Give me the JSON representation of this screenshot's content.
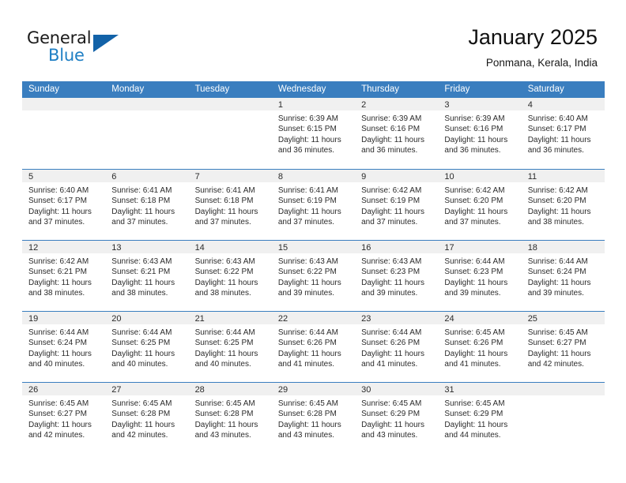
{
  "brand": {
    "word1": "General",
    "word2": "Blue",
    "triangle_color": "#1262a8",
    "blue_color": "#1f7fc4"
  },
  "header": {
    "title": "January 2025",
    "subtitle": "Ponmana, Kerala, India"
  },
  "theme": {
    "header_bar": "#3a7ebf",
    "daynum_bar": "#f0f0f0",
    "text": "#2b2b2b"
  },
  "weekdays": [
    "Sunday",
    "Monday",
    "Tuesday",
    "Wednesday",
    "Thursday",
    "Friday",
    "Saturday"
  ],
  "weeks": [
    [
      {
        "day": "",
        "empty": true
      },
      {
        "day": "",
        "empty": true
      },
      {
        "day": "",
        "empty": true
      },
      {
        "day": "1",
        "sunrise": "Sunrise: 6:39 AM",
        "sunset": "Sunset: 6:15 PM",
        "daylight1": "Daylight: 11 hours",
        "daylight2": "and 36 minutes."
      },
      {
        "day": "2",
        "sunrise": "Sunrise: 6:39 AM",
        "sunset": "Sunset: 6:16 PM",
        "daylight1": "Daylight: 11 hours",
        "daylight2": "and 36 minutes."
      },
      {
        "day": "3",
        "sunrise": "Sunrise: 6:39 AM",
        "sunset": "Sunset: 6:16 PM",
        "daylight1": "Daylight: 11 hours",
        "daylight2": "and 36 minutes."
      },
      {
        "day": "4",
        "sunrise": "Sunrise: 6:40 AM",
        "sunset": "Sunset: 6:17 PM",
        "daylight1": "Daylight: 11 hours",
        "daylight2": "and 36 minutes."
      }
    ],
    [
      {
        "day": "5",
        "sunrise": "Sunrise: 6:40 AM",
        "sunset": "Sunset: 6:17 PM",
        "daylight1": "Daylight: 11 hours",
        "daylight2": "and 37 minutes."
      },
      {
        "day": "6",
        "sunrise": "Sunrise: 6:41 AM",
        "sunset": "Sunset: 6:18 PM",
        "daylight1": "Daylight: 11 hours",
        "daylight2": "and 37 minutes."
      },
      {
        "day": "7",
        "sunrise": "Sunrise: 6:41 AM",
        "sunset": "Sunset: 6:18 PM",
        "daylight1": "Daylight: 11 hours",
        "daylight2": "and 37 minutes."
      },
      {
        "day": "8",
        "sunrise": "Sunrise: 6:41 AM",
        "sunset": "Sunset: 6:19 PM",
        "daylight1": "Daylight: 11 hours",
        "daylight2": "and 37 minutes."
      },
      {
        "day": "9",
        "sunrise": "Sunrise: 6:42 AM",
        "sunset": "Sunset: 6:19 PM",
        "daylight1": "Daylight: 11 hours",
        "daylight2": "and 37 minutes."
      },
      {
        "day": "10",
        "sunrise": "Sunrise: 6:42 AM",
        "sunset": "Sunset: 6:20 PM",
        "daylight1": "Daylight: 11 hours",
        "daylight2": "and 37 minutes."
      },
      {
        "day": "11",
        "sunrise": "Sunrise: 6:42 AM",
        "sunset": "Sunset: 6:20 PM",
        "daylight1": "Daylight: 11 hours",
        "daylight2": "and 38 minutes."
      }
    ],
    [
      {
        "day": "12",
        "sunrise": "Sunrise: 6:42 AM",
        "sunset": "Sunset: 6:21 PM",
        "daylight1": "Daylight: 11 hours",
        "daylight2": "and 38 minutes."
      },
      {
        "day": "13",
        "sunrise": "Sunrise: 6:43 AM",
        "sunset": "Sunset: 6:21 PM",
        "daylight1": "Daylight: 11 hours",
        "daylight2": "and 38 minutes."
      },
      {
        "day": "14",
        "sunrise": "Sunrise: 6:43 AM",
        "sunset": "Sunset: 6:22 PM",
        "daylight1": "Daylight: 11 hours",
        "daylight2": "and 38 minutes."
      },
      {
        "day": "15",
        "sunrise": "Sunrise: 6:43 AM",
        "sunset": "Sunset: 6:22 PM",
        "daylight1": "Daylight: 11 hours",
        "daylight2": "and 39 minutes."
      },
      {
        "day": "16",
        "sunrise": "Sunrise: 6:43 AM",
        "sunset": "Sunset: 6:23 PM",
        "daylight1": "Daylight: 11 hours",
        "daylight2": "and 39 minutes."
      },
      {
        "day": "17",
        "sunrise": "Sunrise: 6:44 AM",
        "sunset": "Sunset: 6:23 PM",
        "daylight1": "Daylight: 11 hours",
        "daylight2": "and 39 minutes."
      },
      {
        "day": "18",
        "sunrise": "Sunrise: 6:44 AM",
        "sunset": "Sunset: 6:24 PM",
        "daylight1": "Daylight: 11 hours",
        "daylight2": "and 39 minutes."
      }
    ],
    [
      {
        "day": "19",
        "sunrise": "Sunrise: 6:44 AM",
        "sunset": "Sunset: 6:24 PM",
        "daylight1": "Daylight: 11 hours",
        "daylight2": "and 40 minutes."
      },
      {
        "day": "20",
        "sunrise": "Sunrise: 6:44 AM",
        "sunset": "Sunset: 6:25 PM",
        "daylight1": "Daylight: 11 hours",
        "daylight2": "and 40 minutes."
      },
      {
        "day": "21",
        "sunrise": "Sunrise: 6:44 AM",
        "sunset": "Sunset: 6:25 PM",
        "daylight1": "Daylight: 11 hours",
        "daylight2": "and 40 minutes."
      },
      {
        "day": "22",
        "sunrise": "Sunrise: 6:44 AM",
        "sunset": "Sunset: 6:26 PM",
        "daylight1": "Daylight: 11 hours",
        "daylight2": "and 41 minutes."
      },
      {
        "day": "23",
        "sunrise": "Sunrise: 6:44 AM",
        "sunset": "Sunset: 6:26 PM",
        "daylight1": "Daylight: 11 hours",
        "daylight2": "and 41 minutes."
      },
      {
        "day": "24",
        "sunrise": "Sunrise: 6:45 AM",
        "sunset": "Sunset: 6:26 PM",
        "daylight1": "Daylight: 11 hours",
        "daylight2": "and 41 minutes."
      },
      {
        "day": "25",
        "sunrise": "Sunrise: 6:45 AM",
        "sunset": "Sunset: 6:27 PM",
        "daylight1": "Daylight: 11 hours",
        "daylight2": "and 42 minutes."
      }
    ],
    [
      {
        "day": "26",
        "sunrise": "Sunrise: 6:45 AM",
        "sunset": "Sunset: 6:27 PM",
        "daylight1": "Daylight: 11 hours",
        "daylight2": "and 42 minutes."
      },
      {
        "day": "27",
        "sunrise": "Sunrise: 6:45 AM",
        "sunset": "Sunset: 6:28 PM",
        "daylight1": "Daylight: 11 hours",
        "daylight2": "and 42 minutes."
      },
      {
        "day": "28",
        "sunrise": "Sunrise: 6:45 AM",
        "sunset": "Sunset: 6:28 PM",
        "daylight1": "Daylight: 11 hours",
        "daylight2": "and 43 minutes."
      },
      {
        "day": "29",
        "sunrise": "Sunrise: 6:45 AM",
        "sunset": "Sunset: 6:28 PM",
        "daylight1": "Daylight: 11 hours",
        "daylight2": "and 43 minutes."
      },
      {
        "day": "30",
        "sunrise": "Sunrise: 6:45 AM",
        "sunset": "Sunset: 6:29 PM",
        "daylight1": "Daylight: 11 hours",
        "daylight2": "and 43 minutes."
      },
      {
        "day": "31",
        "sunrise": "Sunrise: 6:45 AM",
        "sunset": "Sunset: 6:29 PM",
        "daylight1": "Daylight: 11 hours",
        "daylight2": "and 44 minutes."
      },
      {
        "day": "",
        "empty": true
      }
    ]
  ]
}
